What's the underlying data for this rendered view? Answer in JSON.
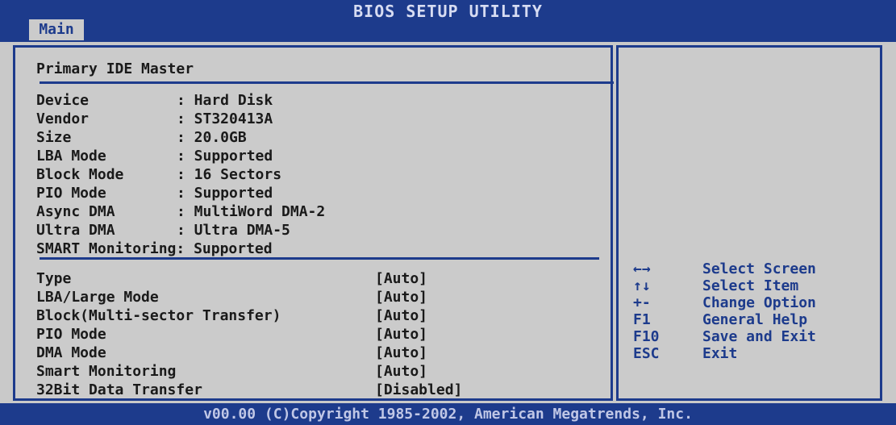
{
  "header": {
    "title": "BIOS SETUP UTILITY",
    "active_tab": "Main"
  },
  "panel": {
    "title": "Primary IDE Master",
    "info": [
      {
        "label": "Device",
        "value": ": Hard Disk"
      },
      {
        "label": "Vendor",
        "value": ": ST320413A"
      },
      {
        "label": "Size",
        "value": ": 20.0GB"
      },
      {
        "label": "LBA Mode",
        "value": ": Supported"
      },
      {
        "label": "Block Mode",
        "value": ": 16 Sectors"
      },
      {
        "label": "PIO Mode",
        "value": ": Supported"
      },
      {
        "label": "Async DMA",
        "value": ": MultiWord DMA-2"
      },
      {
        "label": "Ultra DMA",
        "value": ": Ultra DMA-5"
      }
    ],
    "smart_line": "SMART Monitoring: Supported",
    "settings": [
      {
        "label": "Type",
        "value": "[Auto]"
      },
      {
        "label": "LBA/Large Mode",
        "value": "[Auto]"
      },
      {
        "label": "Block(Multi-sector Transfer)",
        "value": "[Auto]"
      },
      {
        "label": "PIO Mode",
        "value": "[Auto]"
      },
      {
        "label": "DMA Mode",
        "value": "[Auto]"
      },
      {
        "label": "Smart Monitoring",
        "value": "[Auto]"
      },
      {
        "label": "32Bit Data Transfer",
        "value": "[Disabled]"
      }
    ]
  },
  "help_keys": [
    {
      "key": "←→",
      "action": "Select Screen"
    },
    {
      "key": "↑↓",
      "action": "Select Item"
    },
    {
      "key": "+-",
      "action": "Change Option"
    },
    {
      "key": "F1",
      "action": "General Help"
    },
    {
      "key": "F10",
      "action": "Save and Exit"
    },
    {
      "key": "ESC",
      "action": "Exit"
    }
  ],
  "footer": "v00.00 (C)Copyright 1985-2002, American Megatrends, Inc.",
  "colors": {
    "bios_blue": "#1d3b8c",
    "panel_gray": "#cbcbcb",
    "text_dark": "#1a1a1a"
  }
}
